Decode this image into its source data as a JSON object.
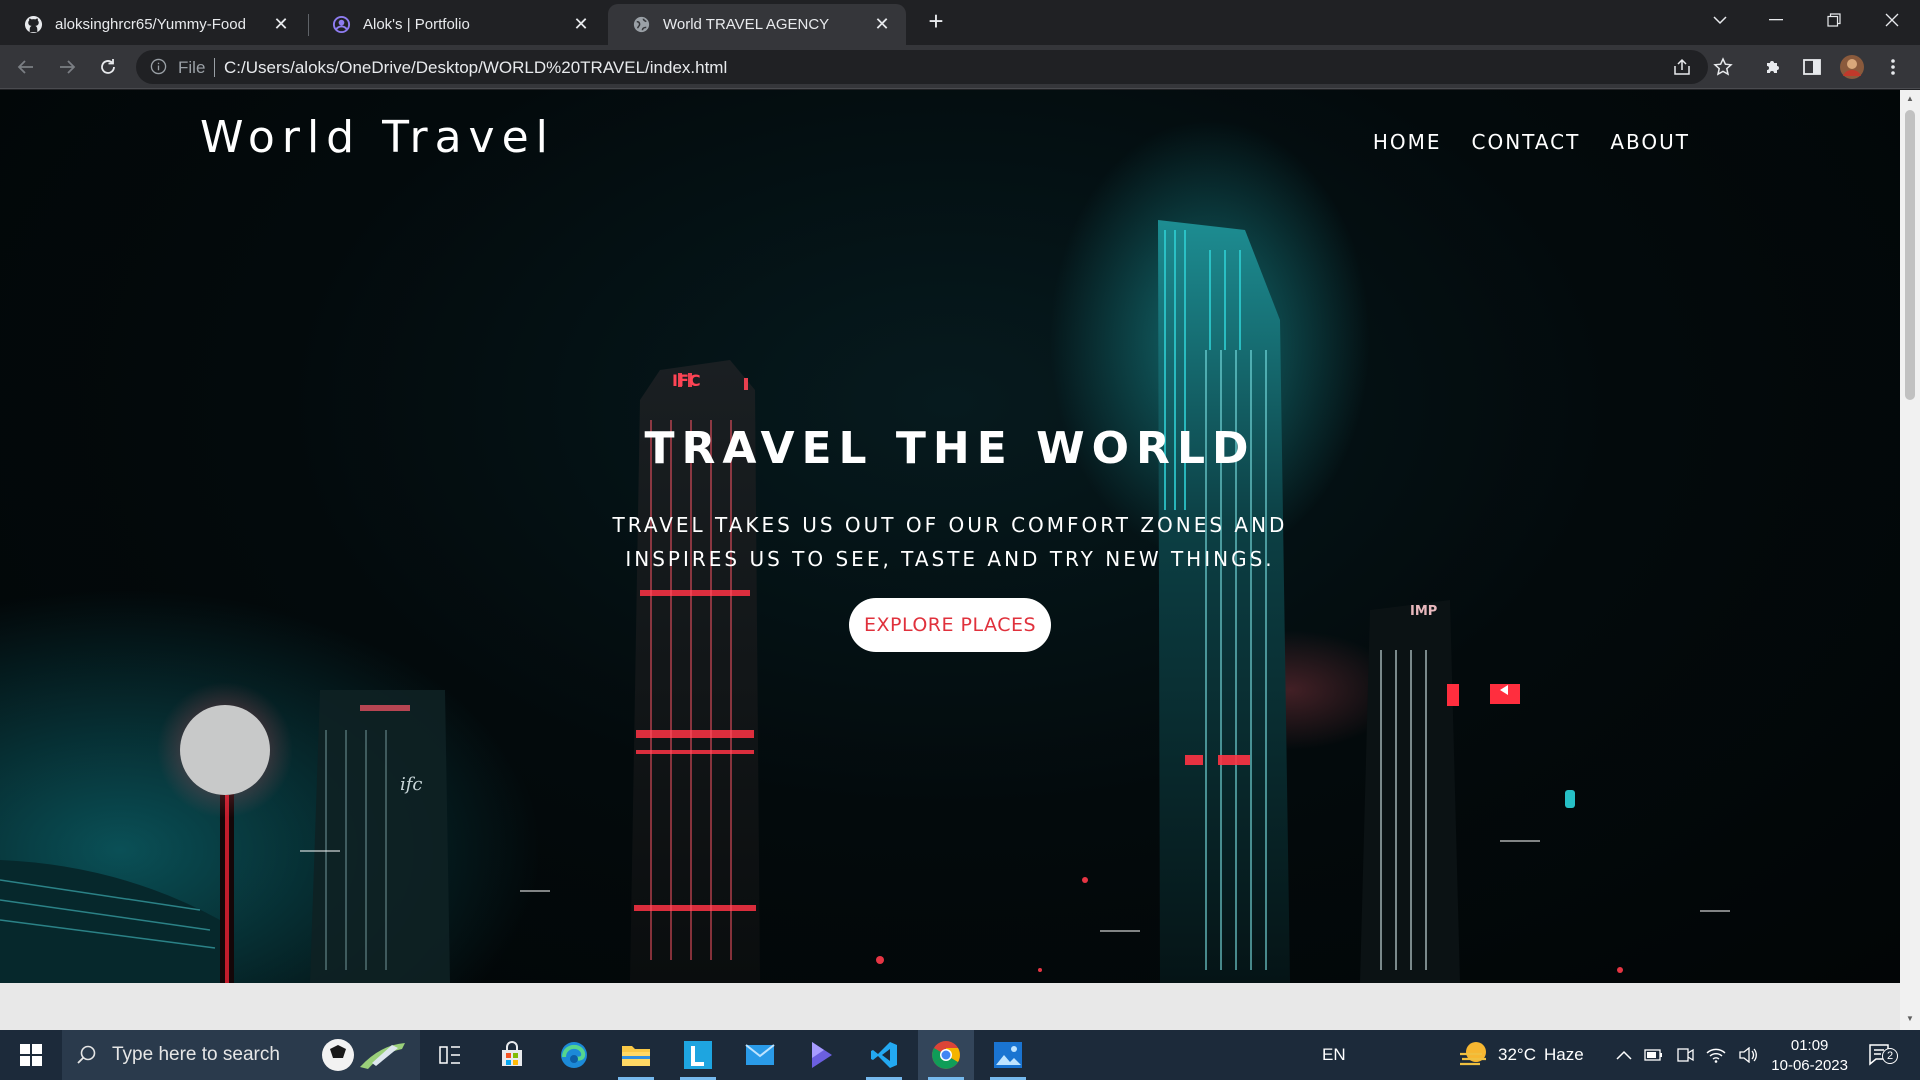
{
  "browser": {
    "tabs": [
      {
        "title": "aloksinghrcr65/Yummy-Food",
        "icon": "github-icon",
        "active": false
      },
      {
        "title": "Alok's | Portfolio",
        "icon": "portfolio-icon",
        "active": false
      },
      {
        "title": "World TRAVEL AGENCY",
        "icon": "globe-icon",
        "active": true
      }
    ],
    "address": {
      "scheme_label": "File",
      "url": "C:/Users/aloks/OneDrive/Desktop/WORLD%20TRAVEL/index.html"
    }
  },
  "page": {
    "brand": "World Travel",
    "nav": {
      "home": "HOME",
      "contact": "CONTACT",
      "about": "ABOUT"
    },
    "hero": {
      "headline": "TRAVEL THE WORLD",
      "tagline_line1": "TRAVEL TAKES US OUT OF OUR COMFORT ZONES AND",
      "tagline_line2": "INSPIRES US TO SEE, TASTE AND TRY NEW THINGS.",
      "cta": "EXPLORE PLACES"
    },
    "signs": {
      "ifc": "IFC",
      "ifc_small": "ifc",
      "imp": "IMP"
    }
  },
  "taskbar": {
    "search_placeholder": "Type here to search",
    "language": "EN",
    "weather": {
      "temp": "32°C",
      "condition": "Haze"
    },
    "time": "01:09",
    "date": "10-06-2023",
    "notification_count": "2"
  },
  "colors": {
    "accent_red": "#e0313c",
    "teal_glow": "#1fb3b8",
    "taskbar_bg": "#1c2a3a"
  }
}
